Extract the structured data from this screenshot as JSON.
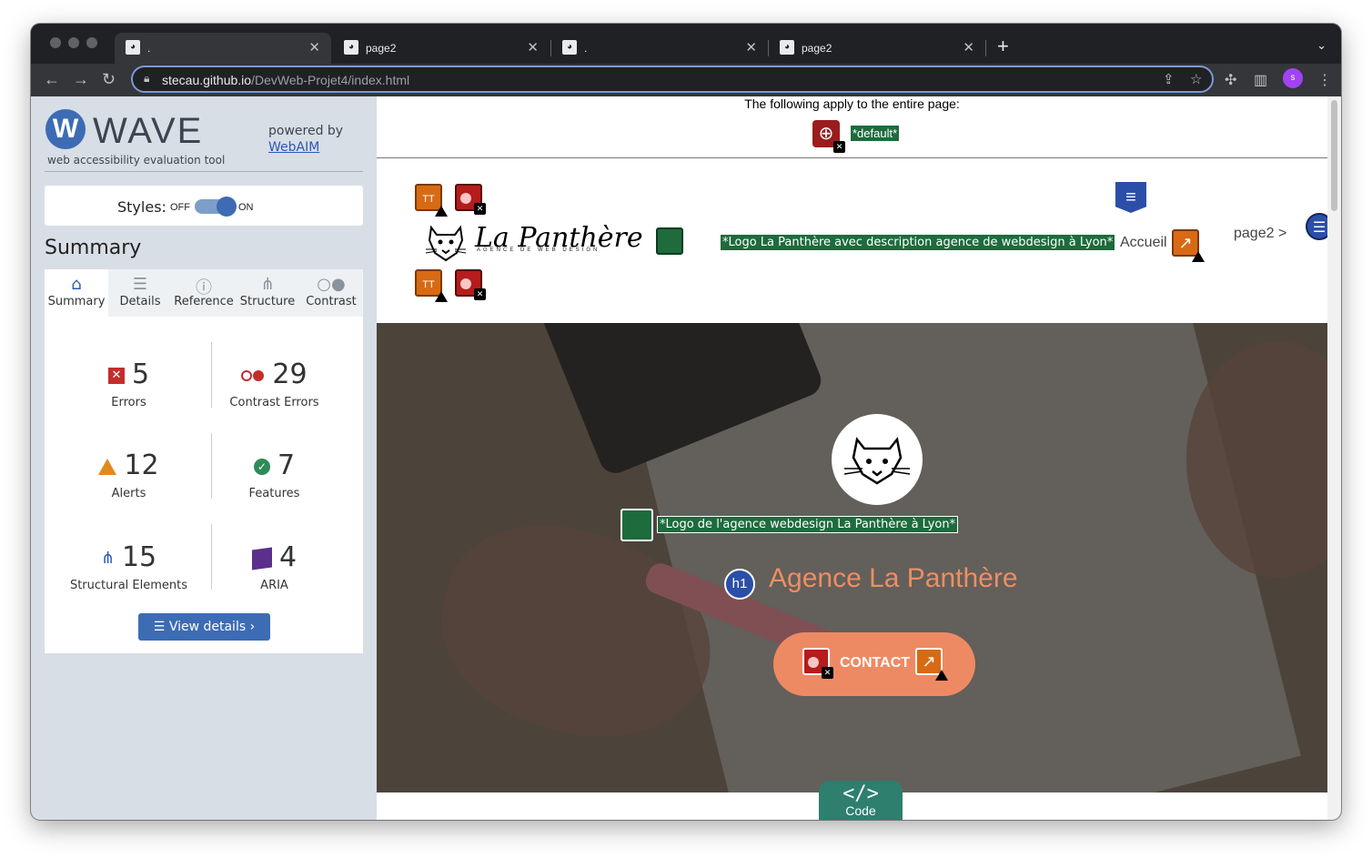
{
  "browser": {
    "tabs": [
      {
        "title": ".",
        "active": true
      },
      {
        "title": "page2",
        "active": false
      },
      {
        "title": ".",
        "active": false
      },
      {
        "title": "page2",
        "active": false
      }
    ],
    "url_host": "stecau.github.io",
    "url_path": "/DevWeb-Projet4/index.html",
    "profile_initial": "s"
  },
  "wave": {
    "logo_letter": "W",
    "title": "WAVE",
    "subtitle": "web accessibility evaluation tool",
    "powered_by": "powered by",
    "webaim": "WebAIM",
    "styles_label": "Styles:",
    "styles_off": "OFF",
    "styles_on": "ON",
    "styles_state": "on",
    "summary_heading": "Summary",
    "tabs": [
      "Summary",
      "Details",
      "Reference",
      "Structure",
      "Contrast"
    ],
    "stats": {
      "errors": {
        "value": "5",
        "label": "Errors"
      },
      "contrast": {
        "value": "29",
        "label": "Contrast Errors"
      },
      "alerts": {
        "value": "12",
        "label": "Alerts"
      },
      "features": {
        "value": "7",
        "label": "Features"
      },
      "structural": {
        "value": "15",
        "label": "Structural Elements"
      },
      "aria": {
        "value": "4",
        "label": "ARIA"
      }
    },
    "view_details": "View details ›"
  },
  "page": {
    "entire_page_note": "The following apply to the entire page:",
    "default_tag": "*default*",
    "brand_name": "La Panthère",
    "brand_sub": "AGENCE DE WEB DESIGN",
    "logo_alt_header": "*Logo La Panthère avec description agence de webdesign à Lyon*",
    "nav_home": "Accueil",
    "nav_page2": "page2 >",
    "logo_alt_hero": "*Logo de l'agence webdesign La Panthère à Lyon*",
    "h1_badge": "h1",
    "hero_title": "Agence La Panthère",
    "contact": "CONTACT",
    "code_glyph": "</>",
    "code_label": "Code"
  },
  "colors": {
    "wave_blue": "#3d6cb4",
    "error_red": "#c62c2c",
    "alert_orange": "#e08a1e",
    "feature_green": "#1e6b3c",
    "aria_purple": "#5b2f8c",
    "hero_accent": "#ee8a63"
  }
}
